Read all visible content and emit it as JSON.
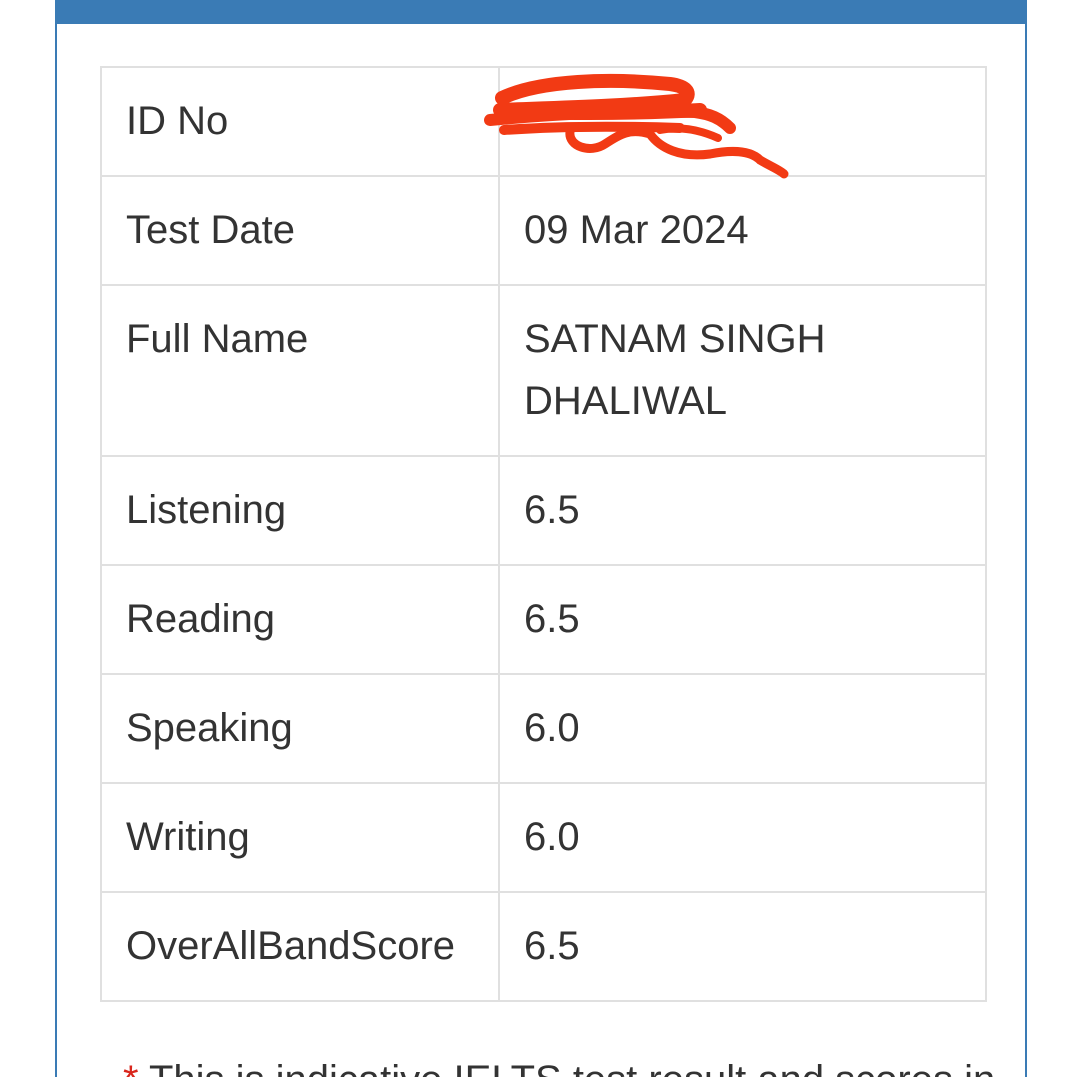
{
  "colors": {
    "header_blue": "#3a7bb5",
    "redaction_red": "#f23a14",
    "text": "#333333",
    "border": "#e0e0e0"
  },
  "results": {
    "rows": [
      {
        "label": "ID No",
        "value": ""
      },
      {
        "label": "Test Date",
        "value": "09 Mar 2024"
      },
      {
        "label": "Full Name",
        "value": "SATNAM SINGH DHALIWAL"
      },
      {
        "label": "Listening",
        "value": "6.5"
      },
      {
        "label": "Reading",
        "value": "6.5"
      },
      {
        "label": "Speaking",
        "value": "6.0"
      },
      {
        "label": "Writing",
        "value": "6.0"
      },
      {
        "label": "OverAllBandScore",
        "value": "6.5"
      }
    ]
  },
  "footnote": {
    "star": "*",
    "text": "This is indicative IELTS test result and scores in"
  }
}
